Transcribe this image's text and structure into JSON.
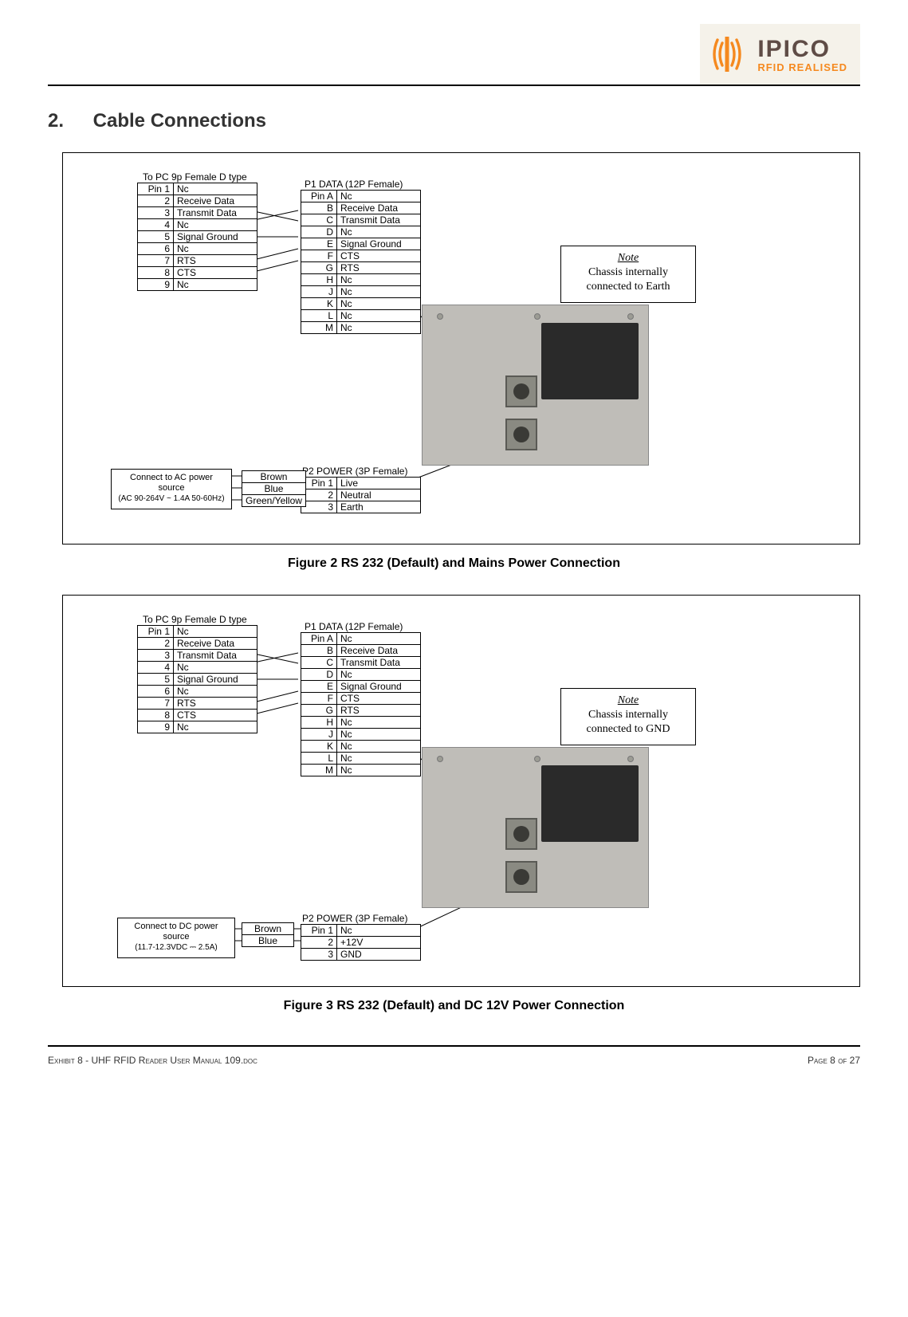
{
  "logo": {
    "name": "IPICO",
    "tagline": "RFID REALISED"
  },
  "section": {
    "number": "2.",
    "title": "Cable Connections"
  },
  "note1": {
    "title": "Note",
    "text": "Chassis internally connected to Earth"
  },
  "note2": {
    "title": "Note",
    "text": "Chassis internally connected to GND"
  },
  "pc_table_title": "To PC 9p Female D type",
  "pc_table": [
    {
      "pin": "Pin 1",
      "sig": "Nc"
    },
    {
      "pin": "2",
      "sig": "Receive Data"
    },
    {
      "pin": "3",
      "sig": "Transmit Data"
    },
    {
      "pin": "4",
      "sig": "Nc"
    },
    {
      "pin": "5",
      "sig": "Signal Ground"
    },
    {
      "pin": "6",
      "sig": "Nc"
    },
    {
      "pin": "7",
      "sig": "RTS"
    },
    {
      "pin": "8",
      "sig": "CTS"
    },
    {
      "pin": "9",
      "sig": "Nc"
    }
  ],
  "p1_table_title": "P1 DATA (12P Female)",
  "p1_table": [
    {
      "pin": "Pin A",
      "sig": "Nc"
    },
    {
      "pin": "B",
      "sig": "Receive Data"
    },
    {
      "pin": "C",
      "sig": "Transmit Data"
    },
    {
      "pin": "D",
      "sig": "Nc"
    },
    {
      "pin": "E",
      "sig": "Signal Ground"
    },
    {
      "pin": "F",
      "sig": "CTS"
    },
    {
      "pin": "G",
      "sig": "RTS"
    },
    {
      "pin": "H",
      "sig": "Nc"
    },
    {
      "pin": "J",
      "sig": "Nc"
    },
    {
      "pin": "K",
      "sig": "Nc"
    },
    {
      "pin": "L",
      "sig": "Nc"
    },
    {
      "pin": "M",
      "sig": "Nc"
    }
  ],
  "p2_title_1": "P2 POWER (3P Female)",
  "p2_table_1": [
    {
      "pin": "Pin 1",
      "sig": "Live"
    },
    {
      "pin": "2",
      "sig": "Neutral"
    },
    {
      "pin": "3",
      "sig": "Earth"
    }
  ],
  "p2_title_2": "P2 POWER (3P Female)",
  "p2_table_2": [
    {
      "pin": "Pin 1",
      "sig": "Nc"
    },
    {
      "pin": "2",
      "sig": "+12V"
    },
    {
      "pin": "3",
      "sig": "GND"
    }
  ],
  "wires_ac": [
    "Brown",
    "Blue",
    "Green/Yellow"
  ],
  "wires_dc": [
    "Brown",
    "Blue"
  ],
  "pwr_src_ac": {
    "line1": "Connect to AC power",
    "line2": "source",
    "line3": "(AC 90-264V ~ 1.4A 50-60Hz)"
  },
  "pwr_src_dc": {
    "line1": "Connect to DC power",
    "line2": "source",
    "line3": "(11.7-12.3VDC ⎓ 2.5A)"
  },
  "captions": {
    "fig2": "Figure 2 RS 232 (Default) and Mains Power Connection",
    "fig3": "Figure 3 RS 232 (Default) and DC 12V Power Connection"
  },
  "footer": {
    "left": "Exhibit 8 - UHF RFID Reader User Manual 109.doc",
    "right_prefix": "Page ",
    "right_page": "8",
    "right_mid": " of ",
    "right_total": "27"
  }
}
